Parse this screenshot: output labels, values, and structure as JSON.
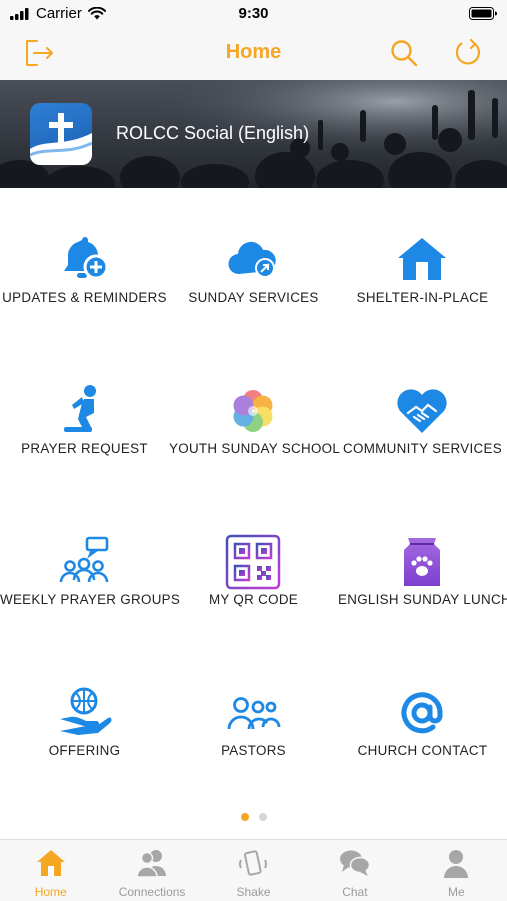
{
  "status_bar": {
    "carrier": "Carrier",
    "time": "9:30"
  },
  "header": {
    "title": "Home",
    "icons": [
      "logout-icon",
      "search-icon",
      "refresh-icon"
    ]
  },
  "banner": {
    "title": "ROLCC Social (English)"
  },
  "grid": {
    "items": [
      {
        "label": "UPDATES & REMINDERS",
        "icon": "bell-plus-icon"
      },
      {
        "label": "SUNDAY SERVICES",
        "icon": "cloud-live-icon"
      },
      {
        "label": "SHELTER-IN-PLACE",
        "icon": "house-icon"
      },
      {
        "label": "PRAYER REQUEST",
        "icon": "kneeling-person-icon"
      },
      {
        "label": "YOUTH SUNDAY SCHOOL",
        "icon": "color-flower-icon"
      },
      {
        "label": "COMMUNITY SERVICES",
        "icon": "heart-handshake-icon"
      },
      {
        "label": "WEEKLY PRAYER GROUPS",
        "icon": "group-chat-icon"
      },
      {
        "label": "MY QR CODE",
        "icon": "qr-code-icon"
      },
      {
        "label": "ENGLISH SUNDAY LUNCH",
        "icon": "food-bag-icon"
      },
      {
        "label": "OFFERING",
        "icon": "globe-hand-icon"
      },
      {
        "label": "PASTORS",
        "icon": "people-icon"
      },
      {
        "label": "CHURCH CONTACT",
        "icon": "at-sign-icon"
      }
    ]
  },
  "pager": {
    "pages": 2,
    "current": 1
  },
  "tabbar": {
    "tabs": [
      {
        "label": "Home",
        "icon": "home-icon",
        "active": true
      },
      {
        "label": "Connections",
        "icon": "connections-icon",
        "active": false
      },
      {
        "label": "Shake",
        "icon": "shake-phone-icon",
        "active": false
      },
      {
        "label": "Chat",
        "icon": "chat-bubbles-icon",
        "active": false
      },
      {
        "label": "Me",
        "icon": "person-icon",
        "active": false
      }
    ]
  },
  "colors": {
    "accent": "#f5a623",
    "icon_blue": "#1e88e5",
    "inactive": "#9b9b9b"
  }
}
